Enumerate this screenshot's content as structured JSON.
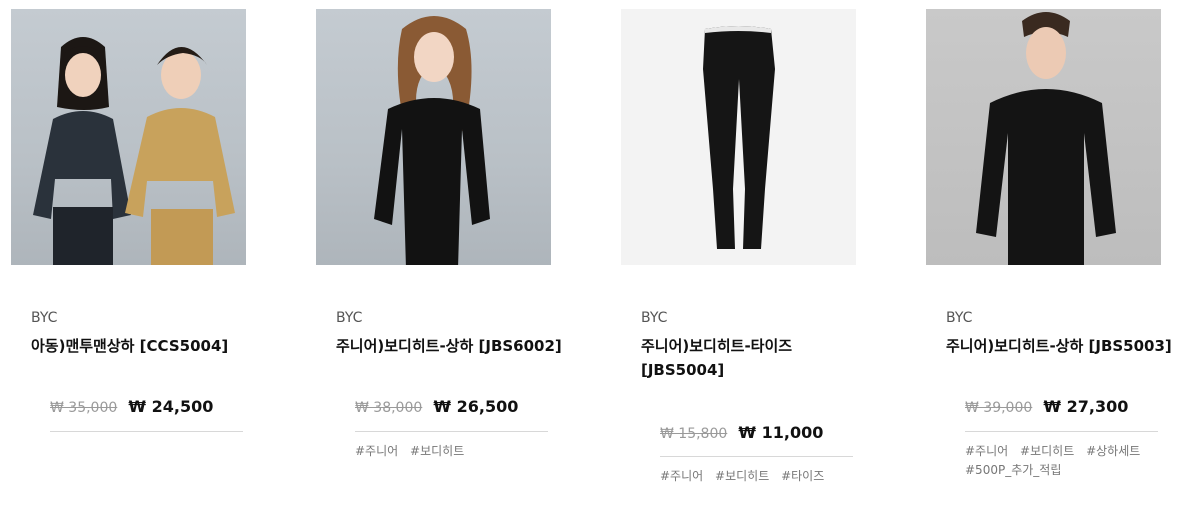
{
  "products": [
    {
      "brand": "BYC",
      "name": "아동)맨투맨상하 [CCS5004]",
      "original_price": "₩ 35,000",
      "sale_price": "₩ 24,500",
      "tags": []
    },
    {
      "brand": "BYC",
      "name": "주니어)보디히트-상하 [JBS6002]",
      "original_price": "₩ 38,000",
      "sale_price": "₩ 26,500",
      "tags": [
        "#주니어",
        "#보디히트"
      ]
    },
    {
      "brand": "BYC",
      "name": "주니어)보디히트-타이즈 [JBS5004]",
      "original_price": "₩ 15,800",
      "sale_price": "₩ 11,000",
      "tags": [
        "#주니어",
        "#보디히트",
        "#타이즈"
      ]
    },
    {
      "brand": "BYC",
      "name": "주니어)보디히트-상하 [JBS5003]",
      "original_price": "₩ 39,000",
      "sale_price": "₩ 27,300",
      "tags": [
        "#주니어",
        "#보디히트",
        "#상하세트",
        "#500P_추가_적립"
      ]
    }
  ]
}
